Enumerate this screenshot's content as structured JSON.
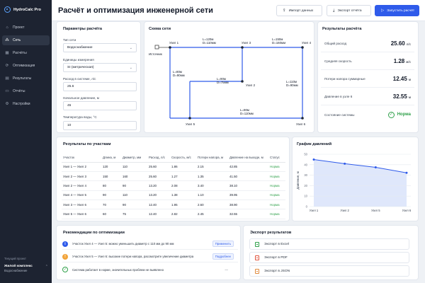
{
  "app": {
    "name": "HydroCalc Pro"
  },
  "sidebar": {
    "items": [
      {
        "label": "Проект",
        "icon": "home-icon"
      },
      {
        "label": "Сеть",
        "icon": "network-icon",
        "active": true
      },
      {
        "label": "Расчёты",
        "icon": "calculator-icon"
      },
      {
        "label": "Оптимизация",
        "icon": "optimize-icon"
      },
      {
        "label": "Результаты",
        "icon": "results-icon"
      },
      {
        "label": "Отчёты",
        "icon": "report-icon"
      },
      {
        "label": "Настройки",
        "icon": "settings-icon"
      }
    ],
    "project_caption": "Текущий проект",
    "project_name": "Жилой комплекс",
    "project_sub": "Водоснабжение"
  },
  "header": {
    "title": "Расчёт и оптимизация инженерной сети",
    "import_label": "Импорт данных",
    "export_label": "Экспорт отчёта",
    "run_label": "Запустить расчёт"
  },
  "params": {
    "title": "Параметры расчёта",
    "network_type_label": "Тип сети",
    "network_type_value": "Водоснабжение",
    "units_label": "Единицы измерения",
    "units_value": "SI (метрическая)",
    "flow_label": "Расход в системе, л/с",
    "flow_value": "25.6",
    "pressure_label": "Начальное давление, м",
    "pressure_value": "45",
    "temp_label": "Температура воды, °C",
    "temp_value": "10"
  },
  "scheme": {
    "title": "Схема сети",
    "source_label": "Источник",
    "nodes": [
      "Узел 1",
      "Узел 2",
      "Узел 3",
      "Узел 4",
      "Узел 5",
      "Узел 6"
    ],
    "pipes": [
      {
        "l": "L=120м",
        "d": "D=110мм"
      },
      {
        "l": "L=150м",
        "d": "D=160мм"
      },
      {
        "l": "L=80м",
        "d": "D=90мм"
      },
      {
        "l": "L=90м",
        "d": "D=75мм"
      },
      {
        "l": "L=110м",
        "d": "D=90мм"
      },
      {
        "l": "L=90м",
        "d": "D=110мм"
      }
    ]
  },
  "results": {
    "title": "Результаты расчёта",
    "items": [
      {
        "label": "Общий расход",
        "value": "25.60",
        "unit": "л/с"
      },
      {
        "label": "Средняя скорость",
        "value": "1.28",
        "unit": "м/с"
      },
      {
        "label": "Потери напора суммарные",
        "value": "12.45",
        "unit": "м"
      },
      {
        "label": "Давление в узле 6",
        "value": "32.55",
        "unit": "м"
      }
    ],
    "status_label": "Состояние системы",
    "status_value": "Норма",
    "status_color": "#2fa04a"
  },
  "table": {
    "title": "Результаты по участкам",
    "headers": [
      "Участок",
      "Длина, м",
      "Диаметр, мм",
      "Расход, л/с",
      "Скорость, м/с",
      "Потери напора, м",
      "Давление на выходе, м",
      "Статус"
    ],
    "rows": [
      [
        "Узел 1 — Узел 2",
        "120",
        "110",
        "25.60",
        "1.86",
        "2.15",
        "42.85",
        "Норма"
      ],
      [
        "Узел 2 — Узел 3",
        "150",
        "160",
        "25.60",
        "1.27",
        "1.35",
        "41.50",
        "Норма"
      ],
      [
        "Узел 2 — Узел 4",
        "80",
        "90",
        "13.20",
        "2.08",
        "3.40",
        "38.10",
        "Норма"
      ],
      [
        "Узел 4 — Узел 5",
        "90",
        "110",
        "13.20",
        "1.38",
        "1.10",
        "39.95",
        "Норма"
      ],
      [
        "Узел 3 — Узел 6",
        "70",
        "90",
        "12.40",
        "1.95",
        "2.60",
        "38.90",
        "Норма"
      ],
      [
        "Узел 5 — Узел 6",
        "60",
        "75",
        "12.40",
        "2.82",
        "2.45",
        "32.55",
        "Норма"
      ]
    ]
  },
  "chart": {
    "title": "График давлений"
  },
  "chart_data": {
    "type": "line",
    "title": "График давлений",
    "categories": [
      "Узел 1",
      "Узел 2",
      "Узел 5",
      "Узел 6"
    ],
    "values": [
      44.9,
      41.0,
      37.5,
      32.3
    ],
    "ylabel": "Давление, м",
    "ylim": [
      0,
      50
    ],
    "yticks": [
      0,
      10,
      20,
      30,
      40,
      50
    ],
    "line_color": "#2f5bea",
    "grid": true
  },
  "recommendations": {
    "title": "Рекомендации по оптимизации",
    "items": [
      {
        "icon": "info-icon",
        "color": "#2f5bea",
        "text": "Участок Узел 4 — Узел 5: можно уменьшить диаметр с 110 мм до 90 мм",
        "action": "Применить"
      },
      {
        "icon": "warning-icon",
        "color": "#f2a43a",
        "text": "Участок Узел 5 — Узел 6: высокие потери напора, рассмотрите увеличение диаметра",
        "action": "Подробнее"
      },
      {
        "icon": "check-icon",
        "color": "#2fa04a",
        "text": "Система работает в норме, значительных проблем не выявлено",
        "action": "—"
      }
    ]
  },
  "export": {
    "title": "Экспорт результатов",
    "items": [
      {
        "label": "Экспорт в Excel",
        "color": "#2fa04a"
      },
      {
        "label": "Экспорт в PDF",
        "color": "#e0533c"
      },
      {
        "label": "Экспорт в JSON",
        "color": "#e08a3c"
      }
    ]
  }
}
